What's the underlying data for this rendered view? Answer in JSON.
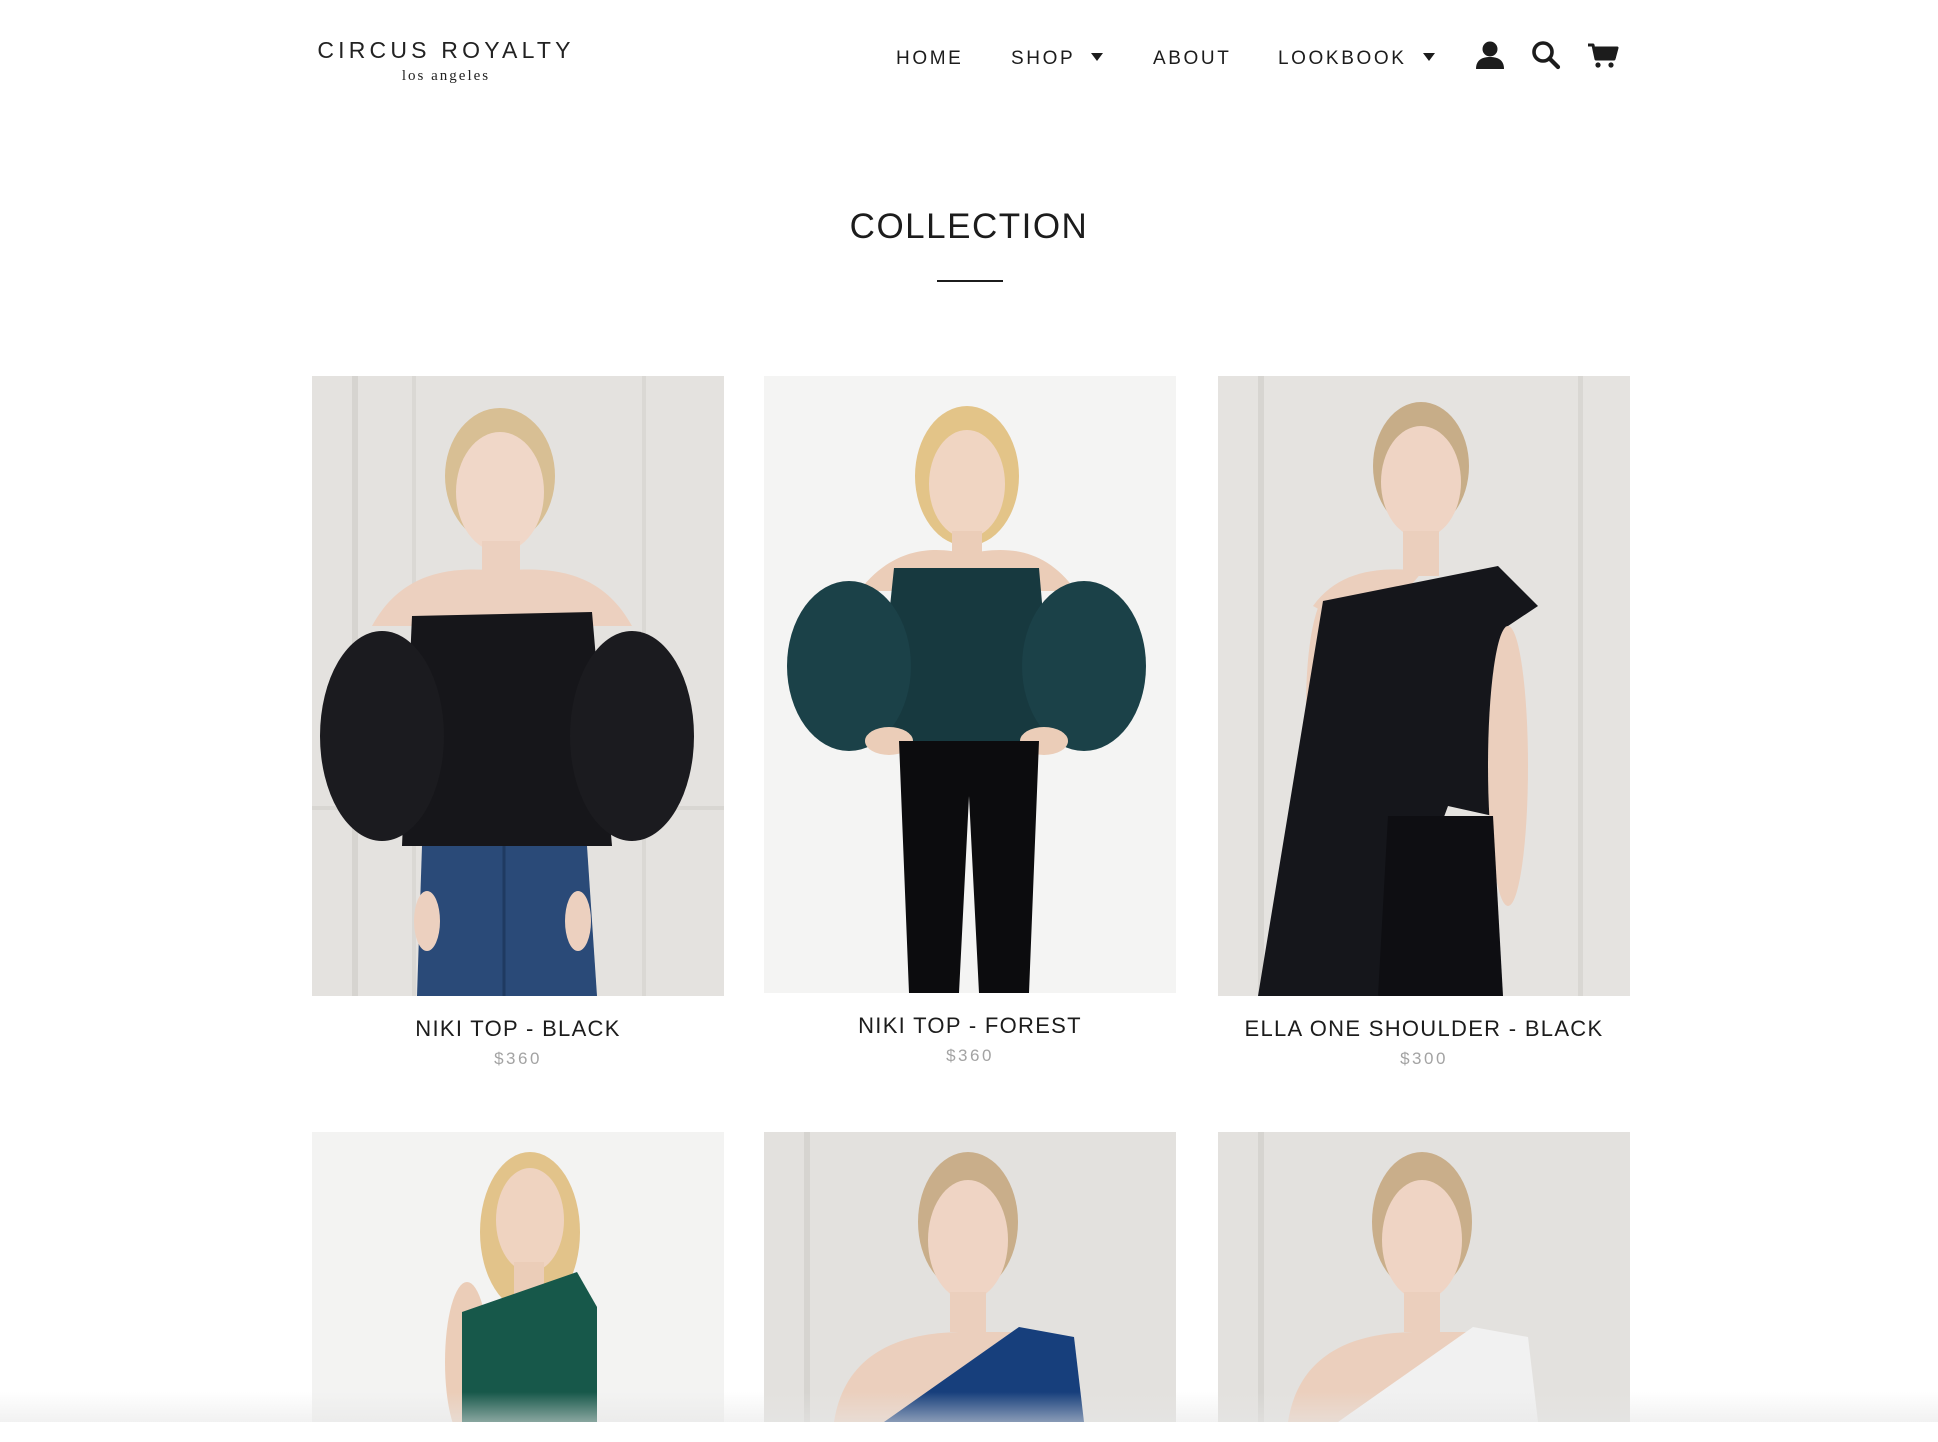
{
  "header": {
    "logo_main": "CIRCUS ROYALTY",
    "logo_sub": "los angeles",
    "nav": [
      {
        "label": "HOME",
        "has_dropdown": false
      },
      {
        "label": "SHOP",
        "has_dropdown": true
      },
      {
        "label": "ABOUT",
        "has_dropdown": false
      },
      {
        "label": "LOOKBOOK",
        "has_dropdown": true
      }
    ],
    "icons": [
      "account-icon",
      "search-icon",
      "cart-icon"
    ]
  },
  "page": {
    "title": "COLLECTION"
  },
  "products": [
    {
      "name": "NIKI TOP - BLACK",
      "price": "$360",
      "garment_color": "#16161a",
      "bottom_color": "#2a4a78",
      "background": "#e4e2df"
    },
    {
      "name": "NIKI TOP - FOREST",
      "price": "$360",
      "garment_color": "#17393f",
      "bottom_color": "#0c0c0e",
      "background": "#f4f4f3"
    },
    {
      "name": "ELLA ONE SHOULDER - BLACK",
      "price": "$300",
      "garment_color": "#15161b",
      "bottom_color": "#0e0e12",
      "background": "#e5e3e0"
    },
    {
      "name": "",
      "price": "",
      "garment_color": "#17584a",
      "bottom_color": "#111111",
      "background": "#f3f3f2"
    },
    {
      "name": "",
      "price": "",
      "garment_color": "#173f7c",
      "bottom_color": "#173f7c",
      "background": "#e3e1de"
    },
    {
      "name": "",
      "price": "",
      "garment_color": "#f1f1f1",
      "bottom_color": "#f1f1f1",
      "background": "#e3e1de"
    }
  ]
}
